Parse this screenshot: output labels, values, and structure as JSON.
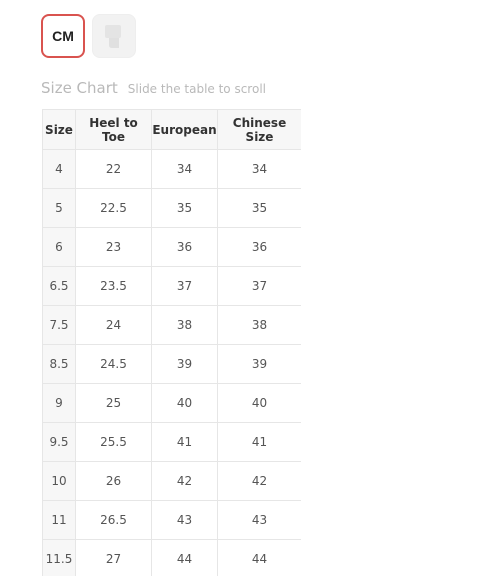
{
  "units": {
    "active_label": "CM",
    "inactive_icon": "ruler-icon"
  },
  "size_chart": {
    "title": "Size Chart",
    "hint": "Slide the table to scroll",
    "headers": [
      "Size",
      "Heel to Toe",
      "European",
      "Chinese Size"
    ],
    "rows": [
      [
        "4",
        "22",
        "34",
        "34"
      ],
      [
        "5",
        "22.5",
        "35",
        "35"
      ],
      [
        "6",
        "23",
        "36",
        "36"
      ],
      [
        "6.5",
        "23.5",
        "37",
        "37"
      ],
      [
        "7.5",
        "24",
        "38",
        "38"
      ],
      [
        "8.5",
        "24.5",
        "39",
        "39"
      ],
      [
        "9",
        "25",
        "40",
        "40"
      ],
      [
        "9.5",
        "25.5",
        "41",
        "41"
      ],
      [
        "10",
        "26",
        "42",
        "42"
      ],
      [
        "11",
        "26.5",
        "43",
        "43"
      ],
      [
        "11.5",
        "27",
        "44",
        "44"
      ]
    ]
  },
  "colors": {
    "active_border": "#d9534f",
    "header_bg": "#f7f7f7",
    "grid": "#e6e6e6"
  }
}
